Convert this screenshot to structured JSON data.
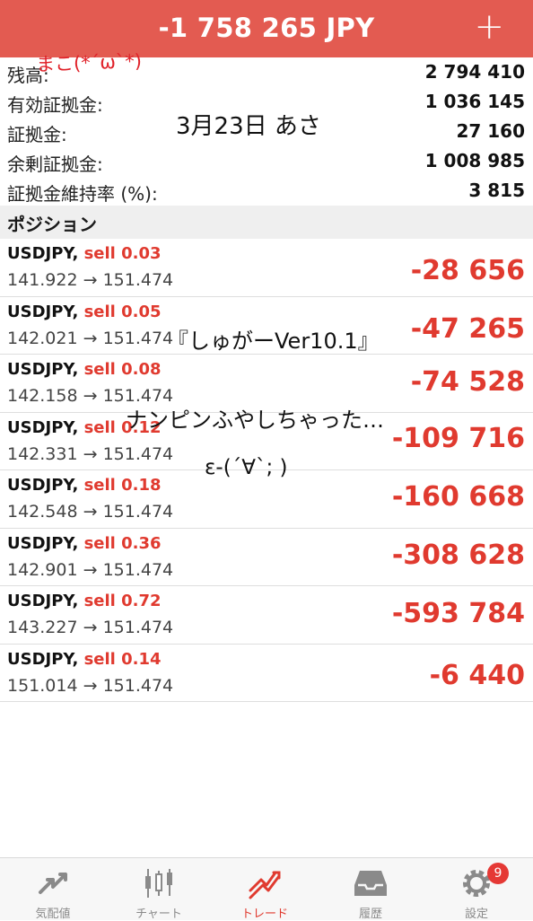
{
  "header": {
    "title": "-1 758 265 JPY",
    "add_label": "+"
  },
  "summary": [
    {
      "label": "残高:",
      "value": "2 794 410"
    },
    {
      "label": "有効証拠金:",
      "value": "1 036 145"
    },
    {
      "label": "証拠金:",
      "value": "27 160"
    },
    {
      "label": "余剰証拠金:",
      "value": "1 008 985"
    },
    {
      "label": "証拠金維持率 (%):",
      "value": "3 815"
    }
  ],
  "section_title": "ポジション",
  "positions": [
    {
      "symbol": "USDJPY,",
      "side": "sell 0.03",
      "prices": "141.922 → 151.474",
      "pnl": "-28 656"
    },
    {
      "symbol": "USDJPY,",
      "side": "sell 0.05",
      "prices": "142.021 → 151.474",
      "pnl": "-47 265"
    },
    {
      "symbol": "USDJPY,",
      "side": "sell 0.08",
      "prices": "142.158 → 151.474",
      "pnl": "-74 528"
    },
    {
      "symbol": "USDJPY,",
      "side": "sell 0.12",
      "prices": "142.331 → 151.474",
      "pnl": "-109 716"
    },
    {
      "symbol": "USDJPY,",
      "side": "sell 0.18",
      "prices": "142.548 → 151.474",
      "pnl": "-160 668"
    },
    {
      "symbol": "USDJPY,",
      "side": "sell 0.36",
      "prices": "142.901 → 151.474",
      "pnl": "-308 628"
    },
    {
      "symbol": "USDJPY,",
      "side": "sell 0.72",
      "prices": "143.227 → 151.474",
      "pnl": "-593 784"
    },
    {
      "symbol": "USDJPY,",
      "side": "sell 0.14",
      "prices": "151.014 → 151.474",
      "pnl": "-6 440"
    }
  ],
  "annotations": {
    "author": "まこ(*´ω`*)",
    "date": "3月23日 あさ",
    "ea_name": "『しゅがーVer10.1』",
    "comment": "ナンピンふやしちゃった…",
    "face": "ε-(´∀`; )"
  },
  "tabs": [
    {
      "label": "気配値",
      "icon": "quotes-icon"
    },
    {
      "label": "チャート",
      "icon": "chart-icon"
    },
    {
      "label": "トレード",
      "icon": "trade-icon",
      "active": true
    },
    {
      "label": "履歴",
      "icon": "history-icon"
    },
    {
      "label": "設定",
      "icon": "settings-icon",
      "badge": "9"
    }
  ],
  "colors": {
    "header": "#e35b51",
    "loss": "#e03a2f",
    "tab_inactive": "#8a8a8a"
  }
}
